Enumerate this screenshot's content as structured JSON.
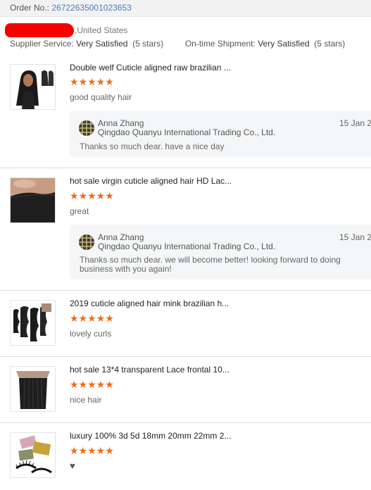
{
  "order": {
    "label": "Order No.:",
    "number": "26722635001023653"
  },
  "buyer": {
    "country": ",United States"
  },
  "ratings": {
    "supplier_label": "Supplier Service:",
    "supplier_value": "Very Satisfied",
    "supplier_stars": "(5 stars)",
    "shipment_label": "On-time Shipment:",
    "shipment_value": "Very Satisfied",
    "shipment_stars": "(5 stars)"
  },
  "star_glyphs": "★★★★★",
  "star_color": "#f36b16",
  "reviews": [
    {
      "title": "Double welf Cuticle aligned raw brazilian ...",
      "rating": 5,
      "comment": "good quality hair",
      "reply": {
        "name": "Anna Zhang",
        "company": "Qingdao Quanyu International Trading Co., Ltd.",
        "date": "15 Jan 2",
        "text": "Thanks so much dear. have a nice day"
      }
    },
    {
      "title": "hot sale virgin cuticle aligned hair HD Lac...",
      "rating": 5,
      "comment": "great",
      "reply": {
        "name": "Anna Zhang",
        "company": "Qingdao Quanyu International Trading Co., Ltd.",
        "date": "15 Jan 2",
        "text": "Thanks so much dear. we will become better! looking forward to doing business with you again!"
      }
    },
    {
      "title": "2019 cuticle aligned hair mink brazilian h...",
      "rating": 5,
      "comment": "lovely curls"
    },
    {
      "title": "hot sale 13*4 transparent Lace frontal 10...",
      "rating": 5,
      "comment": "nice hair"
    },
    {
      "title": "luxury 100% 3d 5d 18mm 20mm 22mm 2...",
      "rating": 5,
      "comment_icon": "heart-icon",
      "comment_glyph": "♥"
    }
  ]
}
